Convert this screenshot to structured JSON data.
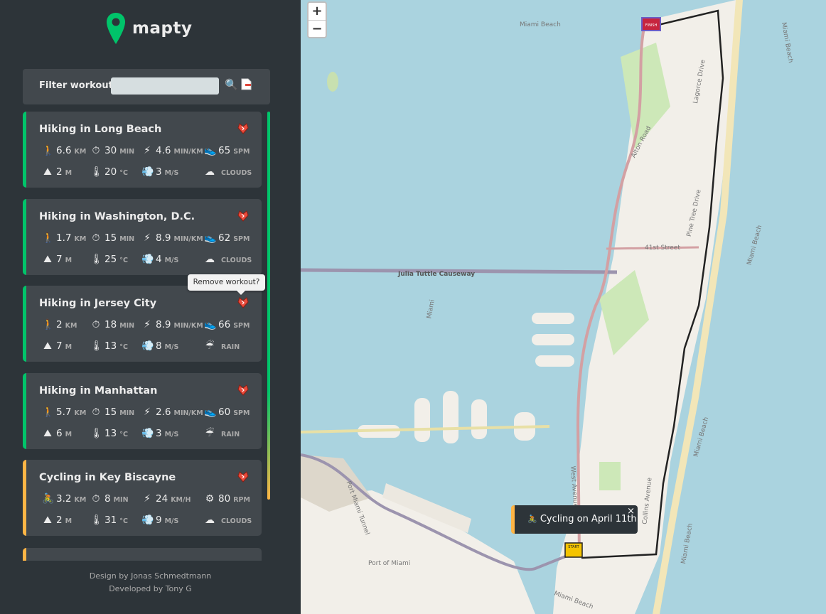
{
  "app": {
    "name": "mapty"
  },
  "filter": {
    "label": "Filter workouts:",
    "value": "",
    "placeholder": ""
  },
  "workouts": [
    {
      "title": "Hiking in Long Beach",
      "type": "hiking",
      "row1": [
        {
          "icon": "person-walking-icon",
          "glyph": "🚶",
          "value": "6.6",
          "unit": "km"
        },
        {
          "icon": "stopwatch-icon",
          "glyph": "⏱",
          "value": "30",
          "unit": "min"
        },
        {
          "icon": "lightning-icon",
          "glyph": "⚡",
          "value": "4.6",
          "unit": "min/km"
        },
        {
          "icon": "shoe-icon",
          "glyph": "👟",
          "value": "65",
          "unit": "spm"
        }
      ],
      "row2": [
        {
          "icon": "mountain-icon",
          "glyph": "⛰",
          "value": "2",
          "unit": "m"
        },
        {
          "icon": "thermometer-icon",
          "glyph": "🌡",
          "value": "20",
          "unit": "°c"
        },
        {
          "icon": "wind-icon",
          "glyph": "💨",
          "value": "3",
          "unit": "m/s"
        },
        {
          "icon": "cloud-icon",
          "glyph": "☁",
          "value": "",
          "unit": "clouds"
        }
      ]
    },
    {
      "title": "Hiking in Washington, D.C.",
      "type": "hiking",
      "row1": [
        {
          "icon": "person-walking-icon",
          "glyph": "🚶",
          "value": "1.7",
          "unit": "km"
        },
        {
          "icon": "stopwatch-icon",
          "glyph": "⏱",
          "value": "15",
          "unit": "min"
        },
        {
          "icon": "lightning-icon",
          "glyph": "⚡",
          "value": "8.9",
          "unit": "min/km"
        },
        {
          "icon": "shoe-icon",
          "glyph": "👟",
          "value": "62",
          "unit": "spm"
        }
      ],
      "row2": [
        {
          "icon": "mountain-icon",
          "glyph": "⛰",
          "value": "7",
          "unit": "m"
        },
        {
          "icon": "thermometer-icon",
          "glyph": "🌡",
          "value": "25",
          "unit": "°c"
        },
        {
          "icon": "wind-icon",
          "glyph": "💨",
          "value": "4",
          "unit": "m/s"
        },
        {
          "icon": "cloud-icon",
          "glyph": "☁",
          "value": "",
          "unit": "clouds"
        }
      ]
    },
    {
      "title": "Hiking in Jersey City",
      "type": "hiking",
      "row1": [
        {
          "icon": "person-walking-icon",
          "glyph": "🚶",
          "value": "2",
          "unit": "km"
        },
        {
          "icon": "stopwatch-icon",
          "glyph": "⏱",
          "value": "18",
          "unit": "min"
        },
        {
          "icon": "lightning-icon",
          "glyph": "⚡",
          "value": "8.9",
          "unit": "min/km"
        },
        {
          "icon": "shoe-icon",
          "glyph": "👟",
          "value": "66",
          "unit": "spm"
        }
      ],
      "row2": [
        {
          "icon": "mountain-icon",
          "glyph": "⛰",
          "value": "7",
          "unit": "m"
        },
        {
          "icon": "thermometer-icon",
          "glyph": "🌡",
          "value": "13",
          "unit": "°c"
        },
        {
          "icon": "wind-icon",
          "glyph": "💨",
          "value": "8",
          "unit": "m/s"
        },
        {
          "icon": "rain-icon",
          "glyph": "☔",
          "value": "",
          "unit": "rain"
        }
      ]
    },
    {
      "title": "Hiking in Manhattan",
      "type": "hiking",
      "row1": [
        {
          "icon": "person-walking-icon",
          "glyph": "🚶",
          "value": "5.7",
          "unit": "km"
        },
        {
          "icon": "stopwatch-icon",
          "glyph": "⏱",
          "value": "15",
          "unit": "min"
        },
        {
          "icon": "lightning-icon",
          "glyph": "⚡",
          "value": "2.6",
          "unit": "min/km"
        },
        {
          "icon": "shoe-icon",
          "glyph": "👟",
          "value": "60",
          "unit": "spm"
        }
      ],
      "row2": [
        {
          "icon": "mountain-icon",
          "glyph": "⛰",
          "value": "6",
          "unit": "m"
        },
        {
          "icon": "thermometer-icon",
          "glyph": "🌡",
          "value": "13",
          "unit": "°c"
        },
        {
          "icon": "wind-icon",
          "glyph": "💨",
          "value": "3",
          "unit": "m/s"
        },
        {
          "icon": "rain-icon",
          "glyph": "☔",
          "value": "",
          "unit": "rain"
        }
      ]
    },
    {
      "title": "Cycling in Key Biscayne",
      "type": "cycling",
      "row1": [
        {
          "icon": "cyclist-icon",
          "glyph": "🚴",
          "value": "3.2",
          "unit": "km"
        },
        {
          "icon": "stopwatch-icon",
          "glyph": "⏱",
          "value": "8",
          "unit": "min"
        },
        {
          "icon": "lightning-icon",
          "glyph": "⚡",
          "value": "24",
          "unit": "km/h"
        },
        {
          "icon": "gear-icon",
          "glyph": "⚙",
          "value": "80",
          "unit": "rpm"
        }
      ],
      "row2": [
        {
          "icon": "mountain-icon",
          "glyph": "⛰",
          "value": "2",
          "unit": "m"
        },
        {
          "icon": "thermometer-icon",
          "glyph": "🌡",
          "value": "31",
          "unit": "°c"
        },
        {
          "icon": "wind-icon",
          "glyph": "💨",
          "value": "9",
          "unit": "m/s"
        },
        {
          "icon": "cloud-icon",
          "glyph": "☁",
          "value": "",
          "unit": "clouds"
        }
      ]
    }
  ],
  "tooltip": {
    "text": "Remove workout?"
  },
  "credits": {
    "line1": "Design by Jonas Schmedtmann",
    "line2": "Developed by Tony G"
  },
  "map": {
    "zoom_in": "+",
    "zoom_out": "−",
    "popup": {
      "text": "Cycling on April 11th",
      "close": "×"
    },
    "labels": [
      "Miami Beach",
      "Julia Tuttle Causeway",
      "41st Street",
      "Alton Road",
      "Pine Tree Drive",
      "Lagorce Drive",
      "West Avenue",
      "Collins Avenue",
      "Port Miami Tunnel",
      "Port of Miami",
      "Miami",
      "Miami Beach",
      "Miami Beach",
      "Miami Beach",
      "Miami Beach",
      "Miami Beach"
    ],
    "start_marker": "START",
    "finish_marker": "FINISH"
  },
  "colors": {
    "hiking": "#00c46a",
    "cycling": "#ffb545",
    "sidebar": "#2d3439",
    "card": "#42484d",
    "water": "#aad3df",
    "land": "#f2efe9"
  }
}
